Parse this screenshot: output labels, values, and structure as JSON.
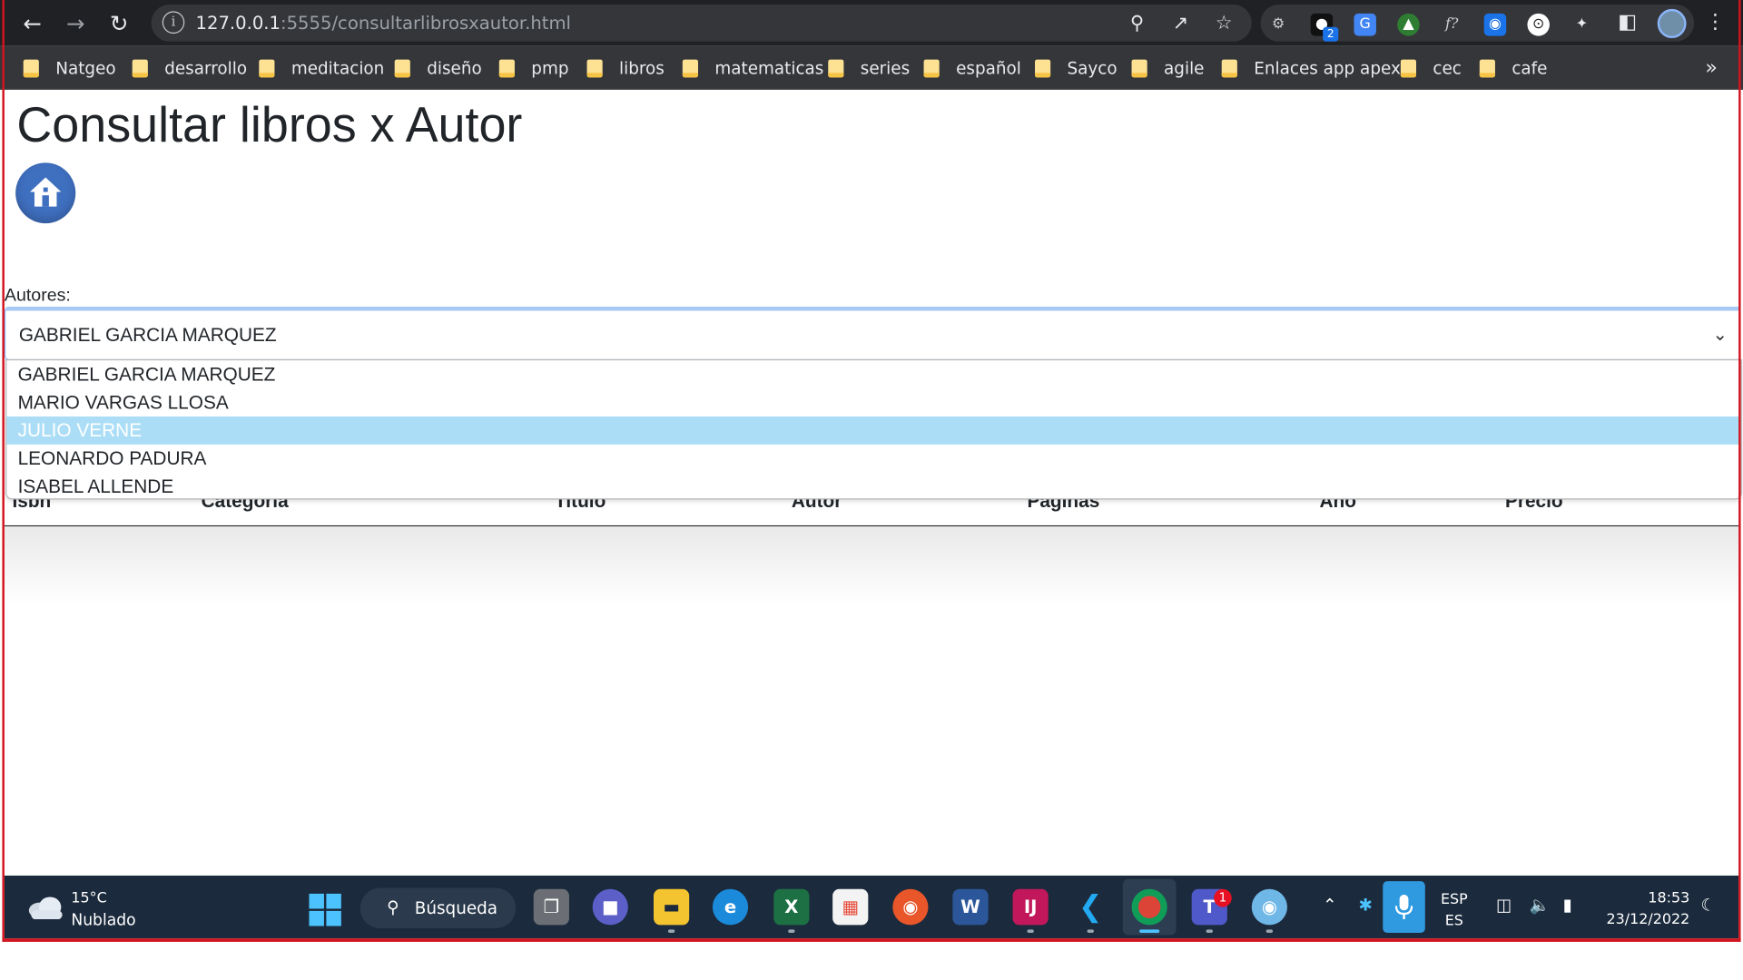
{
  "browser": {
    "url_host": "127.0.0.1",
    "url_path": ":5555/consultarlibrosxautor.html",
    "extension_badge": "2"
  },
  "bookmarks": [
    "Natgeo",
    "desarrollo",
    "meditacion",
    "diseño",
    "pmp",
    "libros",
    "matematicas",
    "series",
    "español",
    "Sayco",
    "agile",
    "Enlaces app apex",
    "cec",
    "cafe"
  ],
  "page": {
    "title": "Consultar libros x Autor",
    "authors_label": "Autores:",
    "selected_author": "GABRIEL GARCIA MARQUEZ",
    "author_options": [
      "GABRIEL GARCIA MARQUEZ",
      "MARIO VARGAS LLOSA",
      "JULIO VERNE",
      "LEONARDO PADURA",
      "ISABEL ALLENDE"
    ],
    "highlighted_option": "JULIO VERNE",
    "table_headers": [
      "Isbn",
      "Categoria",
      "Titulo",
      "Autor",
      "Paginas",
      "Año",
      "Precio"
    ]
  },
  "taskbar": {
    "temperature": "15°C",
    "weather": "Nublado",
    "search_label": "Búsqueda",
    "teams_badge": "1",
    "lang_top": "ESP",
    "lang_bottom": "ES",
    "time": "18:53",
    "date": "23/12/2022"
  },
  "colors": {
    "accent": "#3f6fbf",
    "highlight": "#abdef6",
    "frame": "#d2141e"
  }
}
